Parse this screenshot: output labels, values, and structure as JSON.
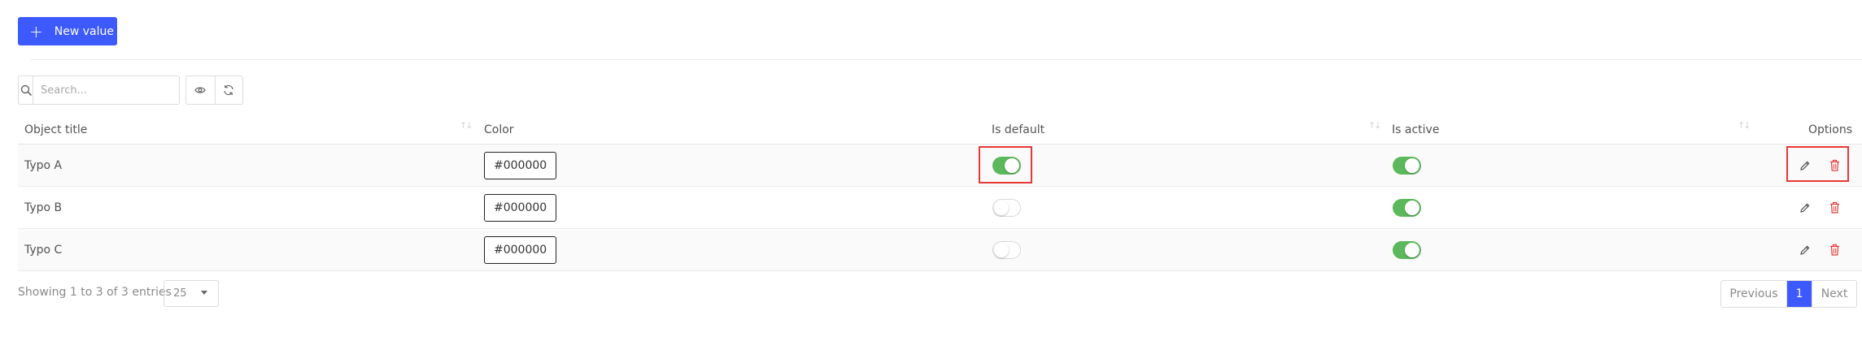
{
  "toolbar": {
    "new_button_label": "New value",
    "search_placeholder": "Search..."
  },
  "table": {
    "columns": [
      "Object title",
      "Color",
      "Is default",
      "Is active",
      "Options"
    ],
    "rows": [
      {
        "title": "Typo A",
        "color": "#000000",
        "is_default": true,
        "is_active": true
      },
      {
        "title": "Typo B",
        "color": "#000000",
        "is_default": false,
        "is_active": true
      },
      {
        "title": "Typo C",
        "color": "#000000",
        "is_default": false,
        "is_active": true
      }
    ]
  },
  "footer": {
    "entries_text": "Showing 1 to 3 of 3 entries",
    "page_size": "25",
    "prev_label": "Previous",
    "current_page": "1",
    "next_label": "Next"
  },
  "colors": {
    "accent": "#3d5afe",
    "toggle_on": "#5cb85c",
    "delete": "#e53935",
    "highlight": "#e53935"
  },
  "icons": [
    "plus-icon",
    "search-icon",
    "eye-icon",
    "refresh-icon",
    "edit-icon",
    "trash-icon",
    "sort-icon"
  ]
}
